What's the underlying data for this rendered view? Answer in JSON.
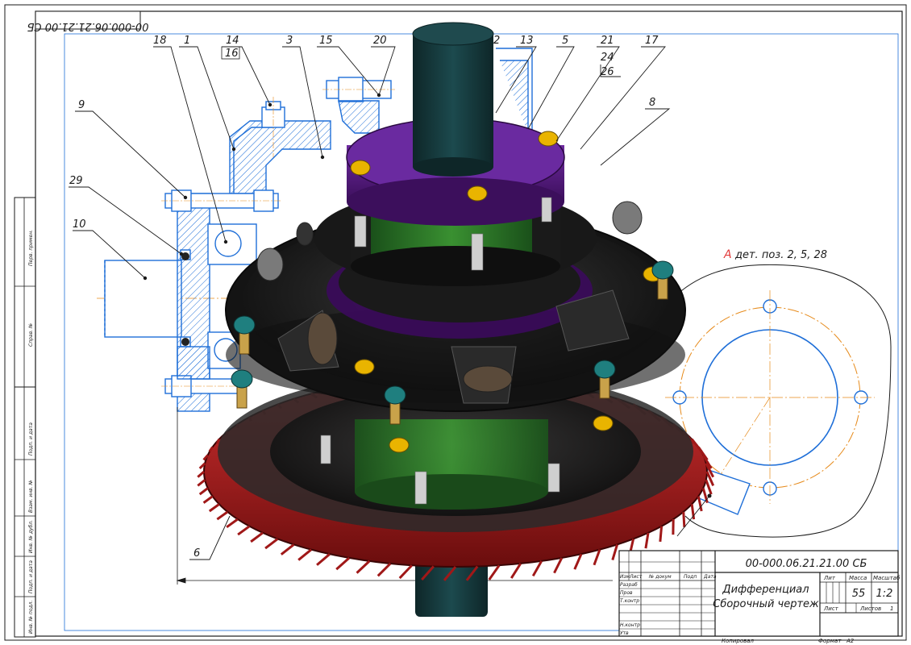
{
  "drawing": {
    "code_topleft": "00-000.06.21.21.00 СБ",
    "code_titleblock": "00-000.06.21.21.00 СБ",
    "title_line1": "Дифференциал",
    "title_line2": "Сборочный чертеж",
    "view_letter": "А",
    "view_label": "дет. поз. 2, 5, 28",
    "mass": "55",
    "scale": "1:2",
    "sheet_label": "Лист",
    "sheets_label": "Листов",
    "sheets_value": "1",
    "lit_label": "Лит",
    "mass_label": "Масса",
    "scale_label": "Масштаб",
    "copied_label": "Копировал",
    "format_label": "Формат",
    "format_value": "А2"
  },
  "callouts": [
    {
      "id": "c18",
      "text": "18"
    },
    {
      "id": "c1",
      "text": "1"
    },
    {
      "id": "c14",
      "text": "14"
    },
    {
      "id": "c16",
      "text": "16"
    },
    {
      "id": "c3",
      "text": "3"
    },
    {
      "id": "c15",
      "text": "15"
    },
    {
      "id": "c20",
      "text": "20"
    },
    {
      "id": "c2",
      "text": "2"
    },
    {
      "id": "c13",
      "text": "13"
    },
    {
      "id": "c5",
      "text": "5"
    },
    {
      "id": "c21",
      "text": "21"
    },
    {
      "id": "c24",
      "text": "24"
    },
    {
      "id": "c26",
      "text": "26"
    },
    {
      "id": "c17",
      "text": "17"
    },
    {
      "id": "c8",
      "text": "8"
    },
    {
      "id": "c9",
      "text": "9"
    },
    {
      "id": "c29",
      "text": "29"
    },
    {
      "id": "c10",
      "text": "10"
    },
    {
      "id": "c6",
      "text": "6"
    }
  ],
  "title_block": {
    "col_izm": "Изм",
    "col_list": "Лист",
    "col_doc": "№ докум",
    "col_sign": "Подп",
    "col_date": "Дата",
    "row_razrab": "Разраб",
    "row_prov": "Пров",
    "row_tkontr": "Т.контр",
    "row_nkontr": "Н.контр",
    "row_utv": "Утв"
  },
  "side_stamps": {
    "s1": "Перв. примен.",
    "s2": "Справ. №",
    "s3": "Подп. и дата",
    "s4": "Взам. инв. №",
    "s5": "Инв. № дубл.",
    "s6": "Подп. и дата",
    "s7": "Инв. № подл."
  },
  "colors": {
    "section_blue": "#1f6fd8",
    "hatch_blue": "#1f6fd8",
    "gear_red": "#c22020",
    "cover_purple": "#5a1d84",
    "shaft_teal": "#14373a",
    "bearing_green": "#2f8a2a",
    "bolt_yellow": "#e9b400",
    "nut_teal": "#1f7f7f",
    "centerline_orange": "#e68a1a",
    "view_red": "#e23b3b"
  }
}
